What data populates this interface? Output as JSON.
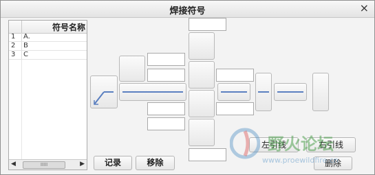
{
  "window": {
    "title": "焊接符号",
    "close_glyph": "×"
  },
  "symbol_table": {
    "header_name": "符号名称",
    "rows": [
      {
        "index": "1",
        "name": "A."
      },
      {
        "index": "2",
        "name": "B"
      },
      {
        "index": "3",
        "name": "C"
      }
    ],
    "scroll": {
      "left_arrow": "◀",
      "right_arrow": "▶",
      "thumb_grip": "IIIII"
    }
  },
  "buttons": {
    "record": "记录",
    "remove": "移除",
    "left_leader": "左引线",
    "right_leader": "右引线",
    "delete": "删除"
  },
  "watermark": {
    "text": "野火论坛",
    "url": "www.proewildfire.cn"
  },
  "colors": {
    "line_blue": "#5a7fc0",
    "watermark_green": "#4aa04a"
  }
}
